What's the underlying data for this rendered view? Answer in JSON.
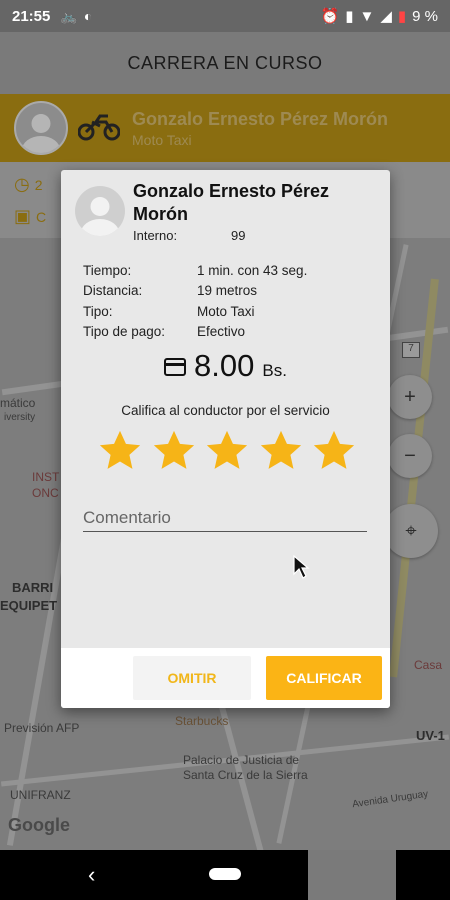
{
  "status_bar": {
    "time": "21:55",
    "battery_text": "9 %",
    "icons": [
      "bike-notification-icon",
      "data-saver-icon",
      "alarm-icon",
      "vibrate-icon",
      "wifi-icon",
      "signal-icon",
      "battery-icon"
    ]
  },
  "app_bar": {
    "title": "CARRERA EN CURSO"
  },
  "driver_bar": {
    "name": "Gonzalo Ernesto Pérez Morón",
    "vehicle_type": "Moto Taxi"
  },
  "sub_row": {
    "time_prefix": "2",
    "card_prefix": "C"
  },
  "map": {
    "labels": {
      "mateo": "mático",
      "university": "iversity",
      "inst": "INST",
      "onc": "ONC",
      "barri": "BARRI",
      "equipet": "EQUIPET",
      "prevision": "Previsión AFP",
      "starbucks": "Starbucks",
      "palacio1": "Palacio de Justicia de",
      "palacio2": "Santa Cruz de la Sierra",
      "unifranz": "UNIFRANZ",
      "uruguay": "Avenida Uruguay",
      "casa": "Casa",
      "uv": "UV-1",
      "route": "7",
      "google": "Google"
    }
  },
  "dialog": {
    "driver_name": "Gonzalo Ernesto Pérez Morón",
    "interno_label": "Interno:",
    "interno_value": "99",
    "details": [
      {
        "label": "Tiempo:",
        "value": "1 min. con 43 seg."
      },
      {
        "label": "Distancia:",
        "value": "19 metros"
      },
      {
        "label": "Tipo:",
        "value": "Moto Taxi"
      },
      {
        "label": "Tipo de pago:",
        "value": "Efectivo"
      }
    ],
    "price": "8.00",
    "currency": "Bs.",
    "rating_prompt": "Califica al conductor por el servicio",
    "rating": 5,
    "max_rating": 5,
    "star_color": "#f6b417",
    "comment_placeholder": "Comentario",
    "skip_label": "OMITIR",
    "rate_label": "CALIFICAR"
  },
  "colors": {
    "accent": "#fbb415",
    "overlay_yellow": "#8a6d10"
  }
}
